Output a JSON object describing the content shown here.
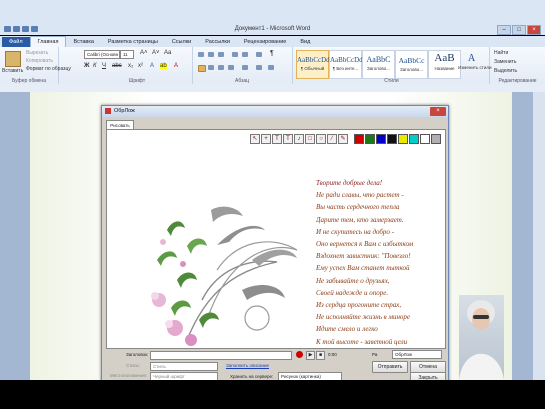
{
  "window": {
    "title": "Документ1 - Microsoft Word",
    "accent": "#2a5ba6"
  },
  "ribbon": {
    "tabs": [
      "Файл",
      "Главная",
      "Вставка",
      "Разметка страницы",
      "Ссылки",
      "Рассылки",
      "Рецензирование",
      "Вид"
    ],
    "active_tab": "Главная",
    "clipboard": {
      "paste_label": "Вставить",
      "cut_label": "Вырезать",
      "copy_label": "Копировать",
      "format_painter_label": "Формат по образцу",
      "group_label": "Буфер обмена"
    },
    "font": {
      "family": "Calibri (Основн",
      "size": "11",
      "group_label": "Шрифт"
    },
    "paragraph": {
      "group_label": "Абзац"
    },
    "styles": [
      {
        "preview": "AaBbCcDd",
        "name": "¶ Обычный"
      },
      {
        "preview": "AaBbCcDd",
        "name": "¶ Без инте..."
      },
      {
        "preview": "AaBbC",
        "name": "Заголово..."
      },
      {
        "preview": "AaBbCc",
        "name": "Заголово..."
      },
      {
        "preview": "AaB",
        "name": "Название"
      }
    ],
    "styles_group_label": "Стили",
    "change_styles_label": "Изменить стили",
    "editing": {
      "find_label": "Найти",
      "replace_label": "Заменить",
      "select_label": "Выделить",
      "group_label": "Редактирование"
    }
  },
  "dialog": {
    "title": "ОбрЛож",
    "tab_label": "Рисовать",
    "toolbar_colors": [
      "#cc0000",
      "#1a7a1a",
      "#0000cc",
      "#111111",
      "#e8e800",
      "#00cccc",
      "#ffffff",
      "#b0b0b0"
    ],
    "toolbar_icons": [
      "cursor-icon",
      "cross-icon",
      "text-icon",
      "t-icon",
      "note-icon",
      "rect-icon",
      "ellipse-icon",
      "line-icon",
      "pen-icon"
    ],
    "poem": [
      "Творите добрые дела!",
      "Не ради славы, что растет -",
      "Вы часть сердечного тепла",
      "Дарите тем, кто замерзает.",
      "И не скупитесь на добро -",
      "Оно вернется к Вам с избытком",
      "Вздохнет завистник: \"Повезло!",
      "Ему успех Вам станет пыткой",
      "Не забывайте о друзьях,",
      "Своей надежде и опоре.",
      "Из сердца прогоните страх,",
      "Не исполняйте жизнь в миноре",
      "Идите смело и легко",
      "К той высоте - заветной цели"
    ],
    "bottom": {
      "title_label": "Заголовок:",
      "title_value": "",
      "style_label": "Стиль:",
      "style_value": "Стиль",
      "location_label": "Местоположение:",
      "location_value": "Черный шрифт",
      "link_label": "Заполнить описание",
      "save_to_server_label": "Хранить на сервере:",
      "save_to_server_value": "Рисунок (картинка)",
      "counter": "0:00",
      "size_label": "Ра",
      "size_value": "ОбрЛож",
      "send_label": "Отправить",
      "cancel_label": "Отмена",
      "close_label": "Закрыть"
    }
  }
}
